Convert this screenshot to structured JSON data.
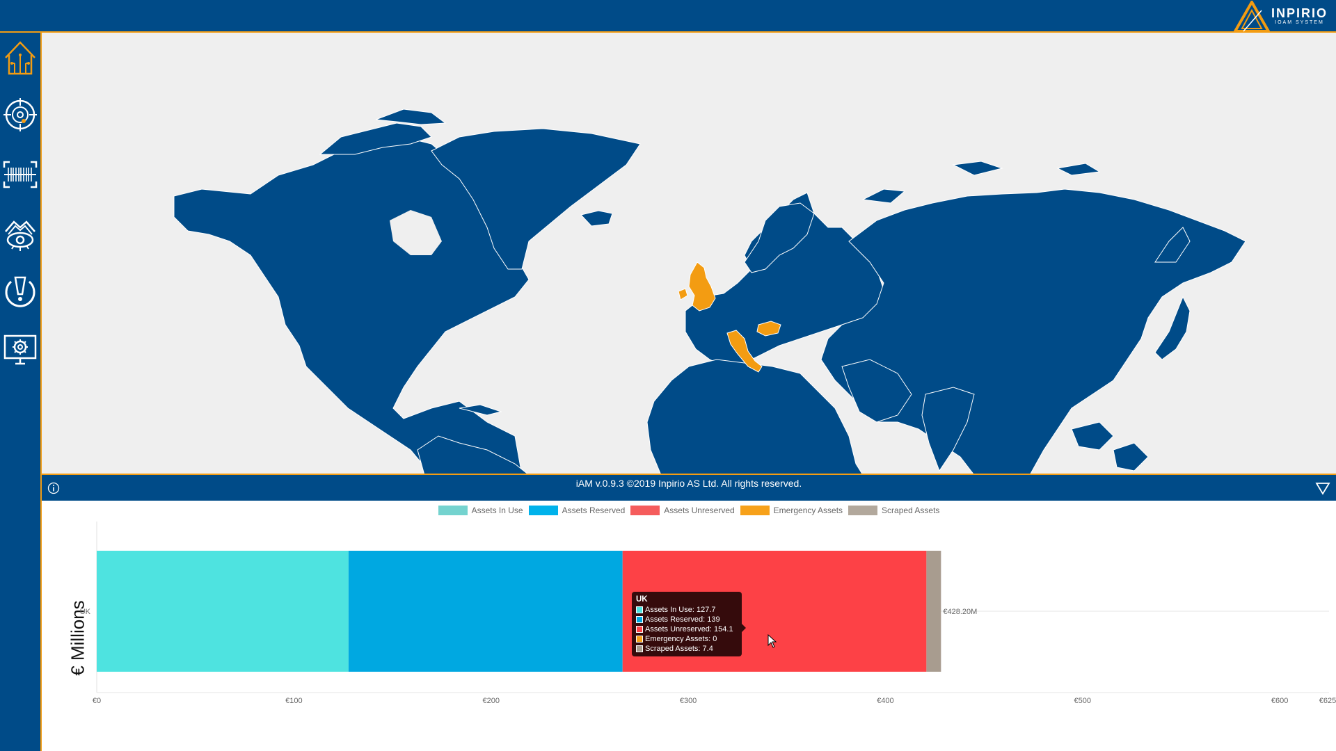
{
  "header": {
    "logo_name": "INPIRIO",
    "logo_sub": "IOAM SYSTEM"
  },
  "sidebar": {
    "items": [
      {
        "name": "home",
        "icon": "home-icon"
      },
      {
        "name": "target",
        "icon": "target-icon"
      },
      {
        "name": "barcode",
        "icon": "barcode-scan-icon"
      },
      {
        "name": "settings-eye",
        "icon": "eye-gear-icon"
      },
      {
        "name": "alerts",
        "icon": "alert-icon"
      },
      {
        "name": "system",
        "icon": "monitor-settings-icon"
      }
    ]
  },
  "map": {
    "highlighted_countries": [
      "UK",
      "Italy",
      "Hungary"
    ],
    "land_color": "#004b88",
    "highlight_color": "#f39c12",
    "water_color": "#efefef"
  },
  "footer": {
    "copyright": "iAM v.0.9.3 ©2019 Inpirio AS Ltd. All rights reserved.",
    "info_icon": "info-icon",
    "collapse_icon": "triangle-down-icon"
  },
  "chart_data": {
    "type": "bar",
    "orientation": "horizontal",
    "stacked": true,
    "categories": [
      "UK"
    ],
    "ylabel": "€ Millions",
    "xlim": [
      0,
      625
    ],
    "x_ticks": [
      "€0",
      "€100",
      "€200",
      "€300",
      "€400",
      "€500",
      "€600",
      "€625"
    ],
    "x_tick_values": [
      0,
      100,
      200,
      300,
      400,
      500,
      600,
      625
    ],
    "total_label": "€428.20M",
    "legend_position": "top",
    "series": [
      {
        "name": "Assets In Use",
        "values": [
          127.7
        ],
        "color": "#4ee3e0",
        "legend_color": "#74d3cf"
      },
      {
        "name": "Assets Reserved",
        "values": [
          139
        ],
        "color": "#00a8e1",
        "legend_color": "#00b2eb"
      },
      {
        "name": "Assets Unreserved",
        "values": [
          154.1
        ],
        "color": "#fd4146",
        "legend_color": "#f55c5c"
      },
      {
        "name": "Emergency Assets",
        "values": [
          0
        ],
        "color": "#f7a11a",
        "legend_color": "#f7a11a"
      },
      {
        "name": "Scraped Assets",
        "values": [
          7.4
        ],
        "color": "#a89c8f",
        "legend_color": "#b2a89c"
      }
    ],
    "tooltip": {
      "title": "UK",
      "rows": [
        "Assets In Use: 127.7",
        "Assets Reserved: 139",
        "Assets Unreserved: 154.1",
        "Emergency Assets: 0",
        "Scraped Assets: 7.4"
      ]
    }
  }
}
